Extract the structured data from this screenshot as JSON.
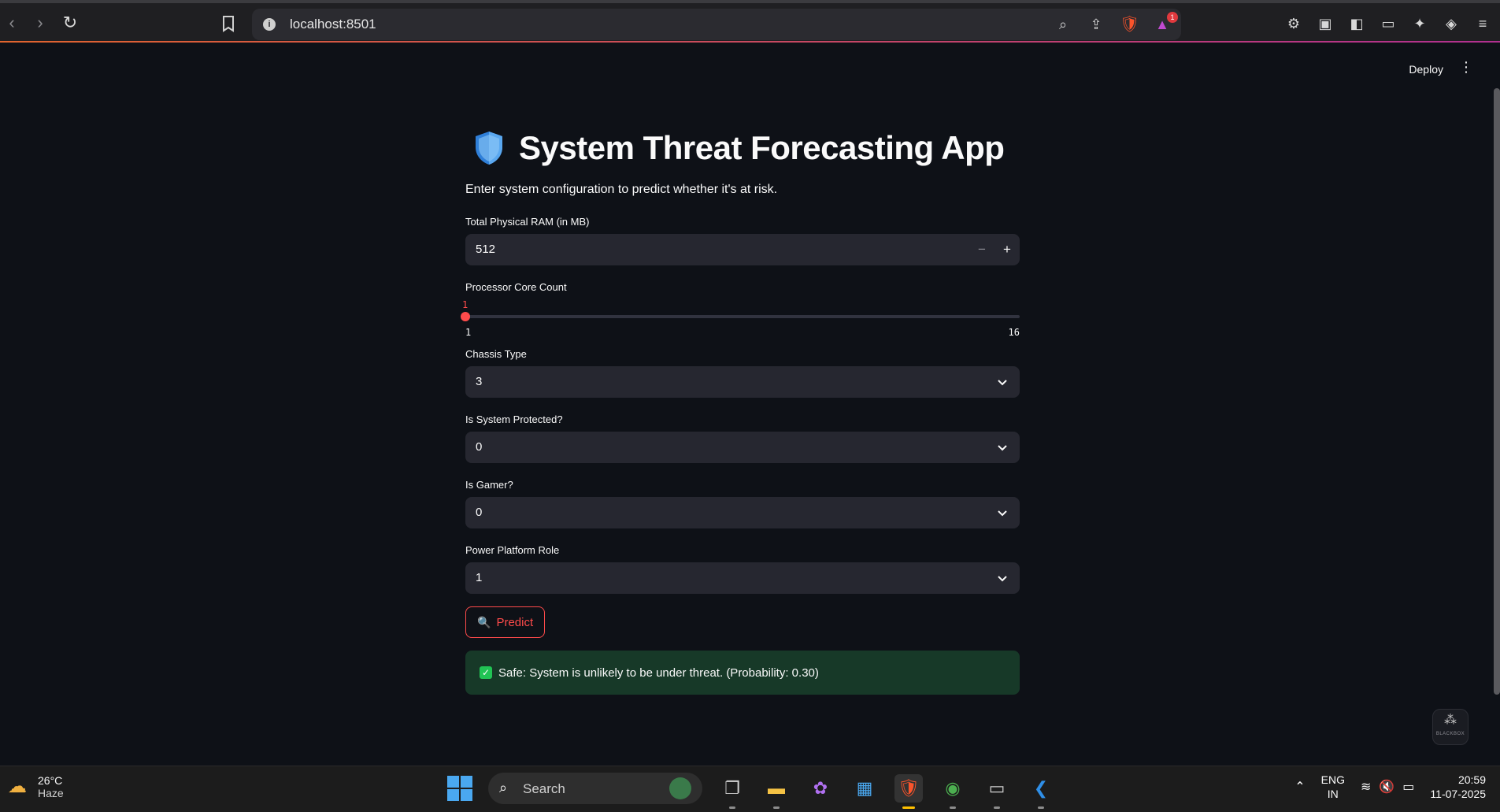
{
  "browser": {
    "url": "localhost:8501",
    "notification_count": "1"
  },
  "app": {
    "deploy_label": "Deploy",
    "title": "System Threat Forecasting App",
    "subtitle": "Enter system configuration to predict whether it's at risk.",
    "ram": {
      "label": "Total Physical RAM (in MB)",
      "value": "512",
      "minus": "−",
      "plus": "+"
    },
    "cores": {
      "label": "Processor Core Count",
      "value": "1",
      "min": "1",
      "max": "16"
    },
    "chassis": {
      "label": "Chassis Type",
      "value": "3"
    },
    "protected": {
      "label": "Is System Protected?",
      "value": "0"
    },
    "gamer": {
      "label": "Is Gamer?",
      "value": "0"
    },
    "power": {
      "label": "Power Platform Role",
      "value": "1"
    },
    "predict_label": "Predict",
    "result": "Safe: System is unlikely to be under threat. (Probability: 0.30)",
    "result_color": "#173928",
    "accent_color": "#ff4b4b",
    "blackbox_label": "BLACKBOX"
  },
  "taskbar": {
    "temperature": "26°C",
    "condition": "Haze",
    "search_placeholder": "Search",
    "lang_top": "ENG",
    "lang_bottom": "IN",
    "time": "20:59",
    "date": "11-07-2025"
  }
}
